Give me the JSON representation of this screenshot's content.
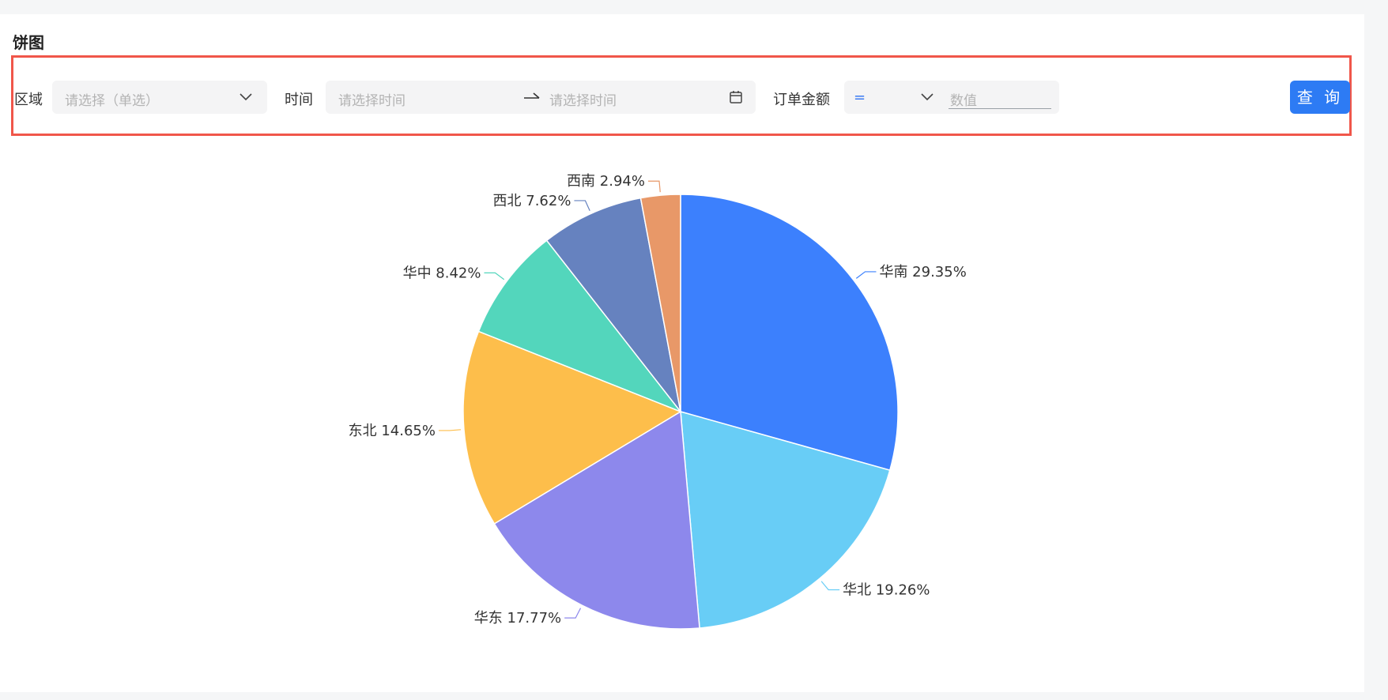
{
  "page": {
    "title": "饼图"
  },
  "filters": {
    "region": {
      "label": "区域",
      "placeholder": "请选择（单选）"
    },
    "time": {
      "label": "时间",
      "start_placeholder": "请选择时间",
      "end_placeholder": "请选择时间"
    },
    "amount": {
      "label": "订单金额",
      "operator": "=",
      "value_placeholder": "数值"
    },
    "query_label": "查 询"
  },
  "colors": {
    "accent": "#2d7bf4",
    "highlight_border": "#f0564a"
  },
  "chart_data": {
    "type": "pie",
    "title": "",
    "slices": [
      {
        "name": "华南",
        "value": 29.35,
        "label": "华南 29.35%",
        "color": "#3c80fd"
      },
      {
        "name": "华北",
        "value": 19.26,
        "label": "华北 19.26%",
        "color": "#68cdf6"
      },
      {
        "name": "华东",
        "value": 17.77,
        "label": "华东 17.77%",
        "color": "#8d88ec"
      },
      {
        "name": "东北",
        "value": 14.65,
        "label": "东北 14.65%",
        "color": "#fdbe4b"
      },
      {
        "name": "华中",
        "value": 8.42,
        "label": "华中 8.42%",
        "color": "#53d6bc"
      },
      {
        "name": "西北",
        "value": 7.62,
        "label": "西北 7.62%",
        "color": "#6682bf"
      },
      {
        "name": "西南",
        "value": 2.94,
        "label": "西南 2.94%",
        "color": "#e89868"
      }
    ],
    "start_angle": "12 o'clock",
    "direction": "clockwise",
    "legend": "none"
  }
}
